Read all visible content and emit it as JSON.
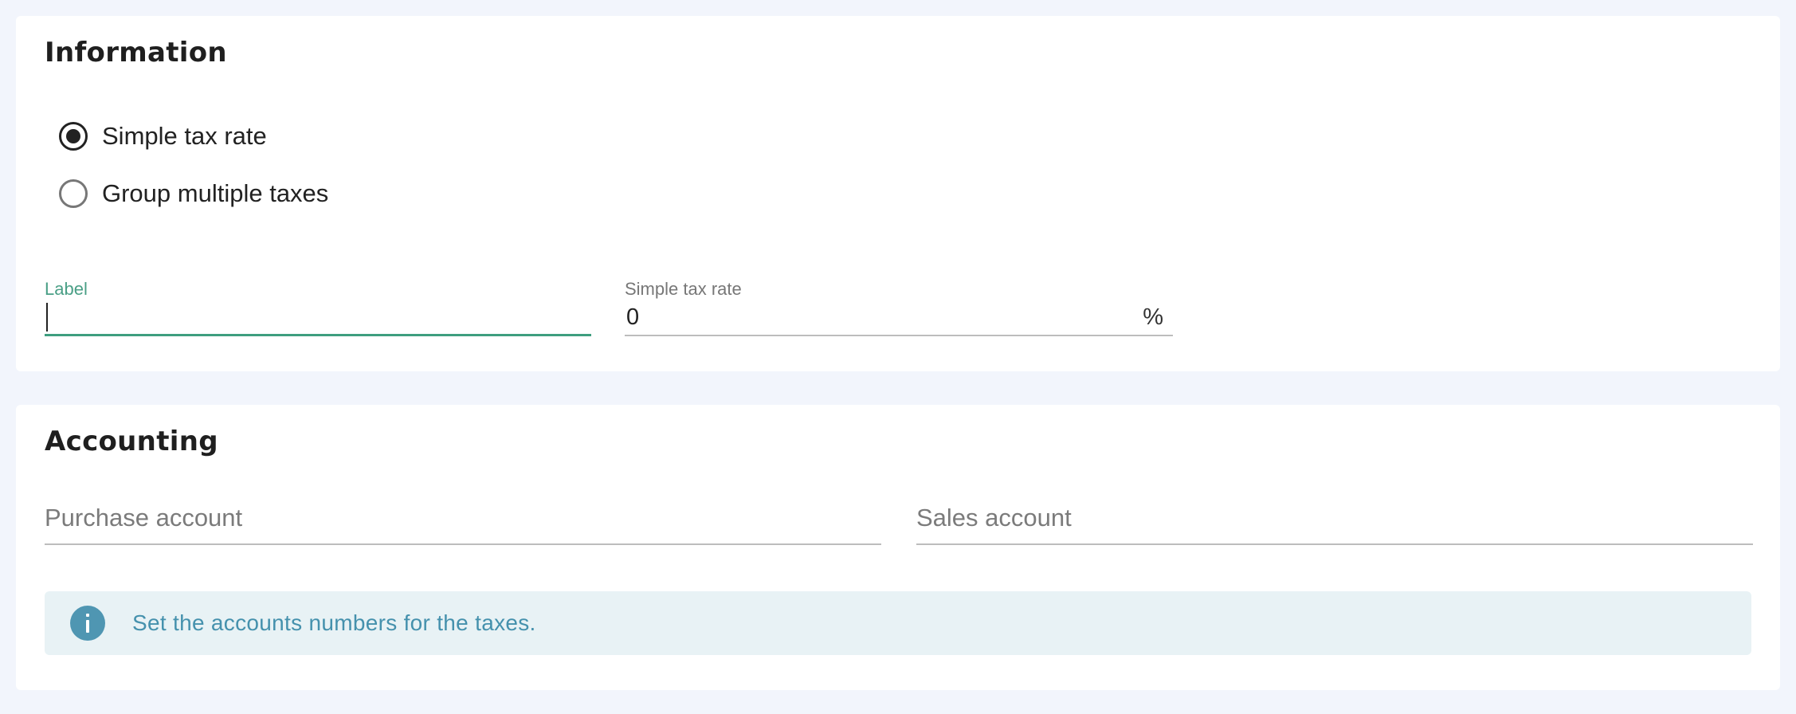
{
  "information": {
    "title": "Information",
    "tax_type_options": [
      {
        "label": "Simple tax rate",
        "selected": true
      },
      {
        "label": "Group multiple taxes",
        "selected": false
      }
    ],
    "label_field": {
      "caption": "Label",
      "value": ""
    },
    "rate_field": {
      "caption": "Simple tax rate",
      "value": "0",
      "suffix": "%"
    }
  },
  "accounting": {
    "title": "Accounting",
    "purchase_account": {
      "placeholder": "Purchase account",
      "value": ""
    },
    "sales_account": {
      "placeholder": "Sales account",
      "value": ""
    },
    "info_message": "Set the accounts numbers for the taxes."
  },
  "colors": {
    "accent_green": "#3e9e7f",
    "info_blue": "#4f96b2",
    "page_background": "#f2f5fc"
  }
}
